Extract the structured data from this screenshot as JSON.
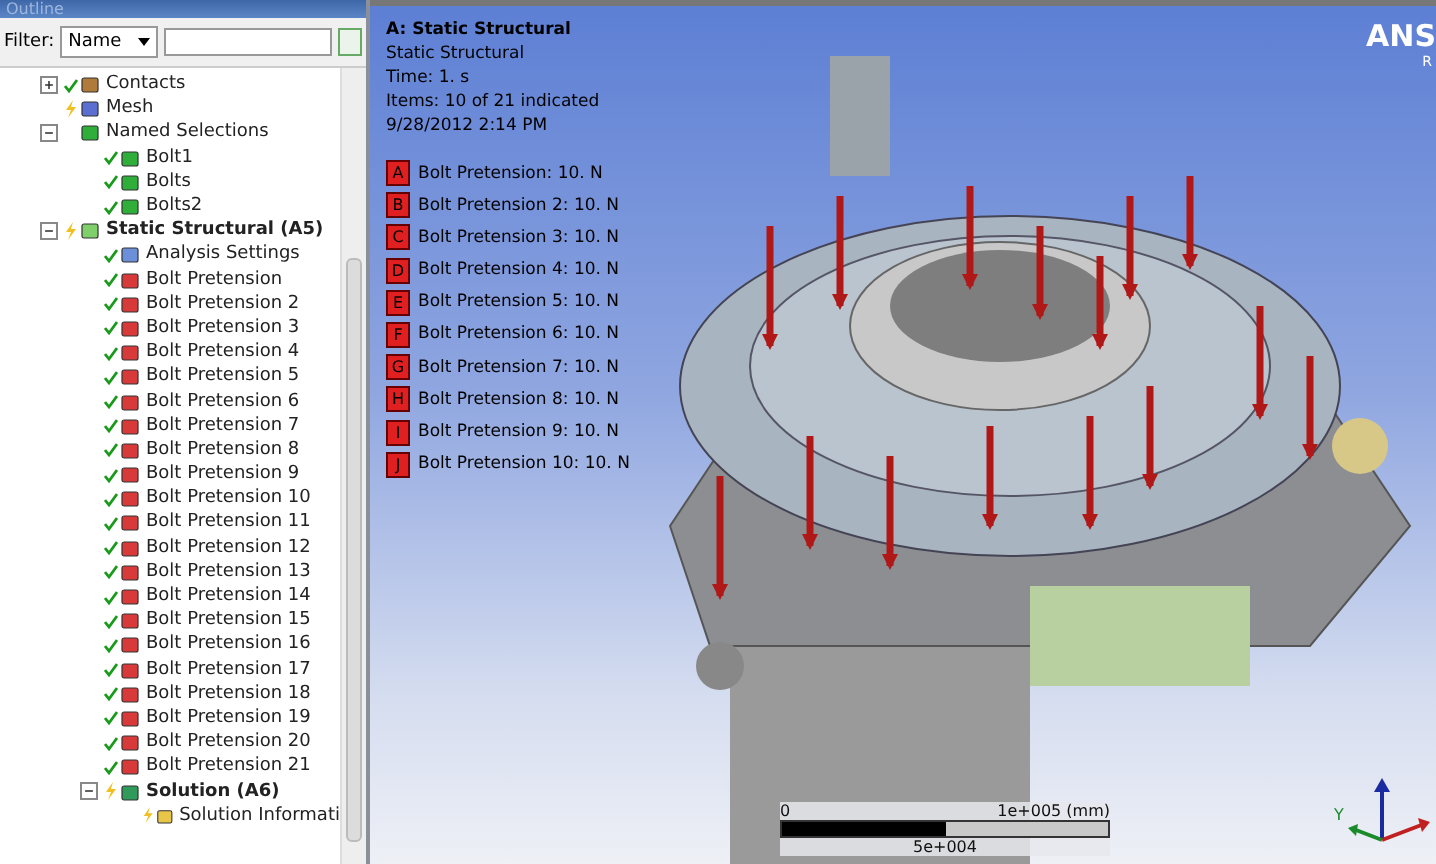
{
  "outline": {
    "title": "Outline",
    "filter_label": "Filter:",
    "filter_choice": "Name",
    "tree": [
      {
        "label": "Contacts",
        "kind": "contacts",
        "up_to_date": true,
        "expanded": false
      },
      {
        "label": "Mesh",
        "kind": "mesh",
        "up_to_date": false
      },
      {
        "label": "Named Selections",
        "kind": "selection",
        "expanded": true,
        "children": [
          {
            "label": "Bolt1",
            "kind": "selection",
            "up_to_date": true
          },
          {
            "label": "Bolts",
            "kind": "selection",
            "up_to_date": true
          },
          {
            "label": "Bolts2",
            "kind": "selection",
            "up_to_date": true
          }
        ]
      },
      {
        "label": "Static Structural (A5)",
        "kind": "analysis",
        "up_to_date": false,
        "expanded": true,
        "children": [
          {
            "label": "Analysis Settings",
            "kind": "settings",
            "up_to_date": true
          },
          {
            "label": "Bolt Pretension",
            "kind": "load",
            "up_to_date": true
          },
          {
            "label": "Bolt Pretension 2",
            "kind": "load",
            "up_to_date": true
          },
          {
            "label": "Bolt Pretension 3",
            "kind": "load",
            "up_to_date": true
          },
          {
            "label": "Bolt Pretension 4",
            "kind": "load",
            "up_to_date": true
          },
          {
            "label": "Bolt Pretension 5",
            "kind": "load",
            "up_to_date": true
          },
          {
            "label": "Bolt Pretension 6",
            "kind": "load",
            "up_to_date": true
          },
          {
            "label": "Bolt Pretension 7",
            "kind": "load",
            "up_to_date": true
          },
          {
            "label": "Bolt Pretension 8",
            "kind": "load",
            "up_to_date": true
          },
          {
            "label": "Bolt Pretension 9",
            "kind": "load",
            "up_to_date": true
          },
          {
            "label": "Bolt Pretension 10",
            "kind": "load",
            "up_to_date": true
          },
          {
            "label": "Bolt Pretension 11",
            "kind": "load",
            "up_to_date": true
          },
          {
            "label": "Bolt Pretension 12",
            "kind": "load",
            "up_to_date": true
          },
          {
            "label": "Bolt Pretension 13",
            "kind": "load",
            "up_to_date": true
          },
          {
            "label": "Bolt Pretension 14",
            "kind": "load",
            "up_to_date": true
          },
          {
            "label": "Bolt Pretension 15",
            "kind": "load",
            "up_to_date": true
          },
          {
            "label": "Bolt Pretension 16",
            "kind": "load",
            "up_to_date": true
          },
          {
            "label": "Bolt Pretension 17",
            "kind": "load",
            "up_to_date": true
          },
          {
            "label": "Bolt Pretension 18",
            "kind": "load",
            "up_to_date": true
          },
          {
            "label": "Bolt Pretension 19",
            "kind": "load",
            "up_to_date": true
          },
          {
            "label": "Bolt Pretension 20",
            "kind": "load",
            "up_to_date": true
          },
          {
            "label": "Bolt Pretension 21",
            "kind": "load",
            "up_to_date": true
          },
          {
            "label": "Solution (A6)",
            "kind": "solution",
            "up_to_date": false,
            "expanded": true,
            "children": [
              {
                "label": "Solution Informati",
                "kind": "info",
                "up_to_date": false
              }
            ]
          }
        ]
      }
    ]
  },
  "viewport": {
    "title": "A: Static Structural",
    "info": [
      "Static Structural",
      "Time: 1. s",
      "Items: 10 of 21 indicated",
      "9/28/2012 2:14 PM"
    ],
    "legend": [
      {
        "letter": "A",
        "label": "Bolt Pretension: 10. N"
      },
      {
        "letter": "B",
        "label": "Bolt Pretension 2: 10. N"
      },
      {
        "letter": "C",
        "label": "Bolt Pretension 3: 10. N"
      },
      {
        "letter": "D",
        "label": "Bolt Pretension 4: 10. N"
      },
      {
        "letter": "E",
        "label": "Bolt Pretension 5: 10. N"
      },
      {
        "letter": "F",
        "label": "Bolt Pretension 6: 10. N"
      },
      {
        "letter": "G",
        "label": "Bolt Pretension 7: 10. N"
      },
      {
        "letter": "H",
        "label": "Bolt Pretension 8: 10. N"
      },
      {
        "letter": "I",
        "label": "Bolt Pretension 9: 10. N"
      },
      {
        "letter": "J",
        "label": "Bolt Pretension 10: 10. N"
      }
    ],
    "logo": "ANS",
    "logo_sub": "R",
    "scale": {
      "start": "0",
      "end": "1e+005 (mm)",
      "mid": "5e+004"
    },
    "triad_label": "Y"
  }
}
